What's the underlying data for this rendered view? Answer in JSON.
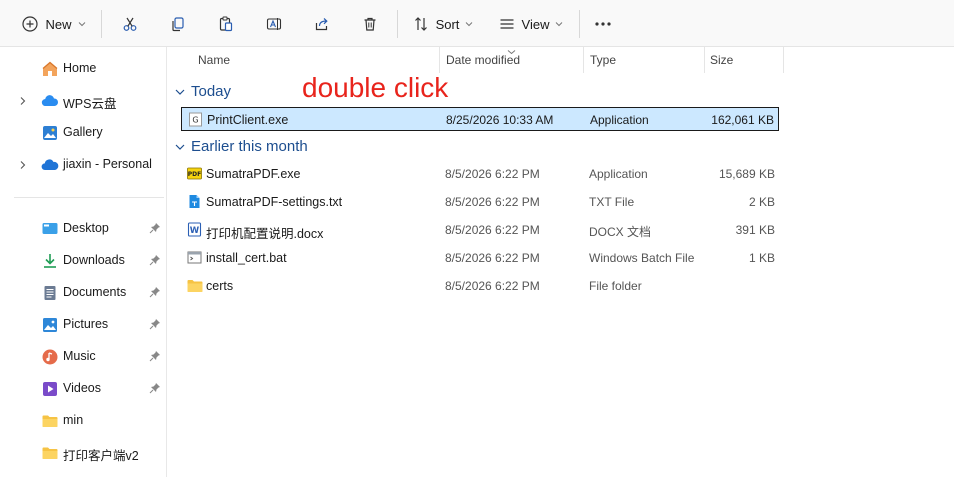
{
  "toolbar": {
    "new_label": "New",
    "sort_label": "Sort",
    "view_label": "View"
  },
  "sidebar": {
    "items": [
      {
        "label": "Home",
        "icon": "home-icon"
      },
      {
        "label": "WPS云盘",
        "icon": "cloud-icon"
      },
      {
        "label": "Gallery",
        "icon": "gallery-icon"
      },
      {
        "label": "jiaxin - Personal",
        "icon": "onedrive-icon"
      },
      {
        "label": "Desktop",
        "icon": "desktop-icon"
      },
      {
        "label": "Downloads",
        "icon": "download-icon"
      },
      {
        "label": "Documents",
        "icon": "documents-icon"
      },
      {
        "label": "Pictures",
        "icon": "pictures-icon"
      },
      {
        "label": "Music",
        "icon": "music-icon"
      },
      {
        "label": "Videos",
        "icon": "videos-icon"
      },
      {
        "label": "min",
        "icon": "folder-icon"
      },
      {
        "label": "打印客户端v2",
        "icon": "folder-icon"
      }
    ]
  },
  "columns": {
    "name": "Name",
    "date": "Date modified",
    "type": "Type",
    "size": "Size"
  },
  "groups": {
    "today": "Today",
    "earlier": "Earlier this month"
  },
  "files": [
    {
      "name": "PrintClient.exe",
      "date": "8/25/2026 10:33 AM",
      "type": "Application",
      "size": "162,061 KB",
      "icon": "exe-icon"
    },
    {
      "name": "SumatraPDF.exe",
      "date": "8/5/2026 6:22 PM",
      "type": "Application",
      "size": "15,689 KB",
      "icon": "pdf-app-icon"
    },
    {
      "name": "SumatraPDF-settings.txt",
      "date": "8/5/2026 6:22 PM",
      "type": "TXT File",
      "size": "2 KB",
      "icon": "txt-file-icon"
    },
    {
      "name": "打印机配置说明.docx",
      "date": "8/5/2026 6:22 PM",
      "type": "DOCX 文档",
      "size": "391 KB",
      "icon": "word-doc-icon"
    },
    {
      "name": "install_cert.bat",
      "date": "8/5/2026 6:22 PM",
      "type": "Windows Batch File",
      "size": "1 KB",
      "icon": "batch-file-icon"
    },
    {
      "name": "certs",
      "date": "8/5/2026 6:22 PM",
      "type": "File folder",
      "size": "",
      "icon": "folder-icon"
    }
  ],
  "annotation": "double click",
  "colors": {
    "selection": "#cce8ff",
    "annotation": "#e8241c",
    "group_header": "#1d4e8f"
  }
}
